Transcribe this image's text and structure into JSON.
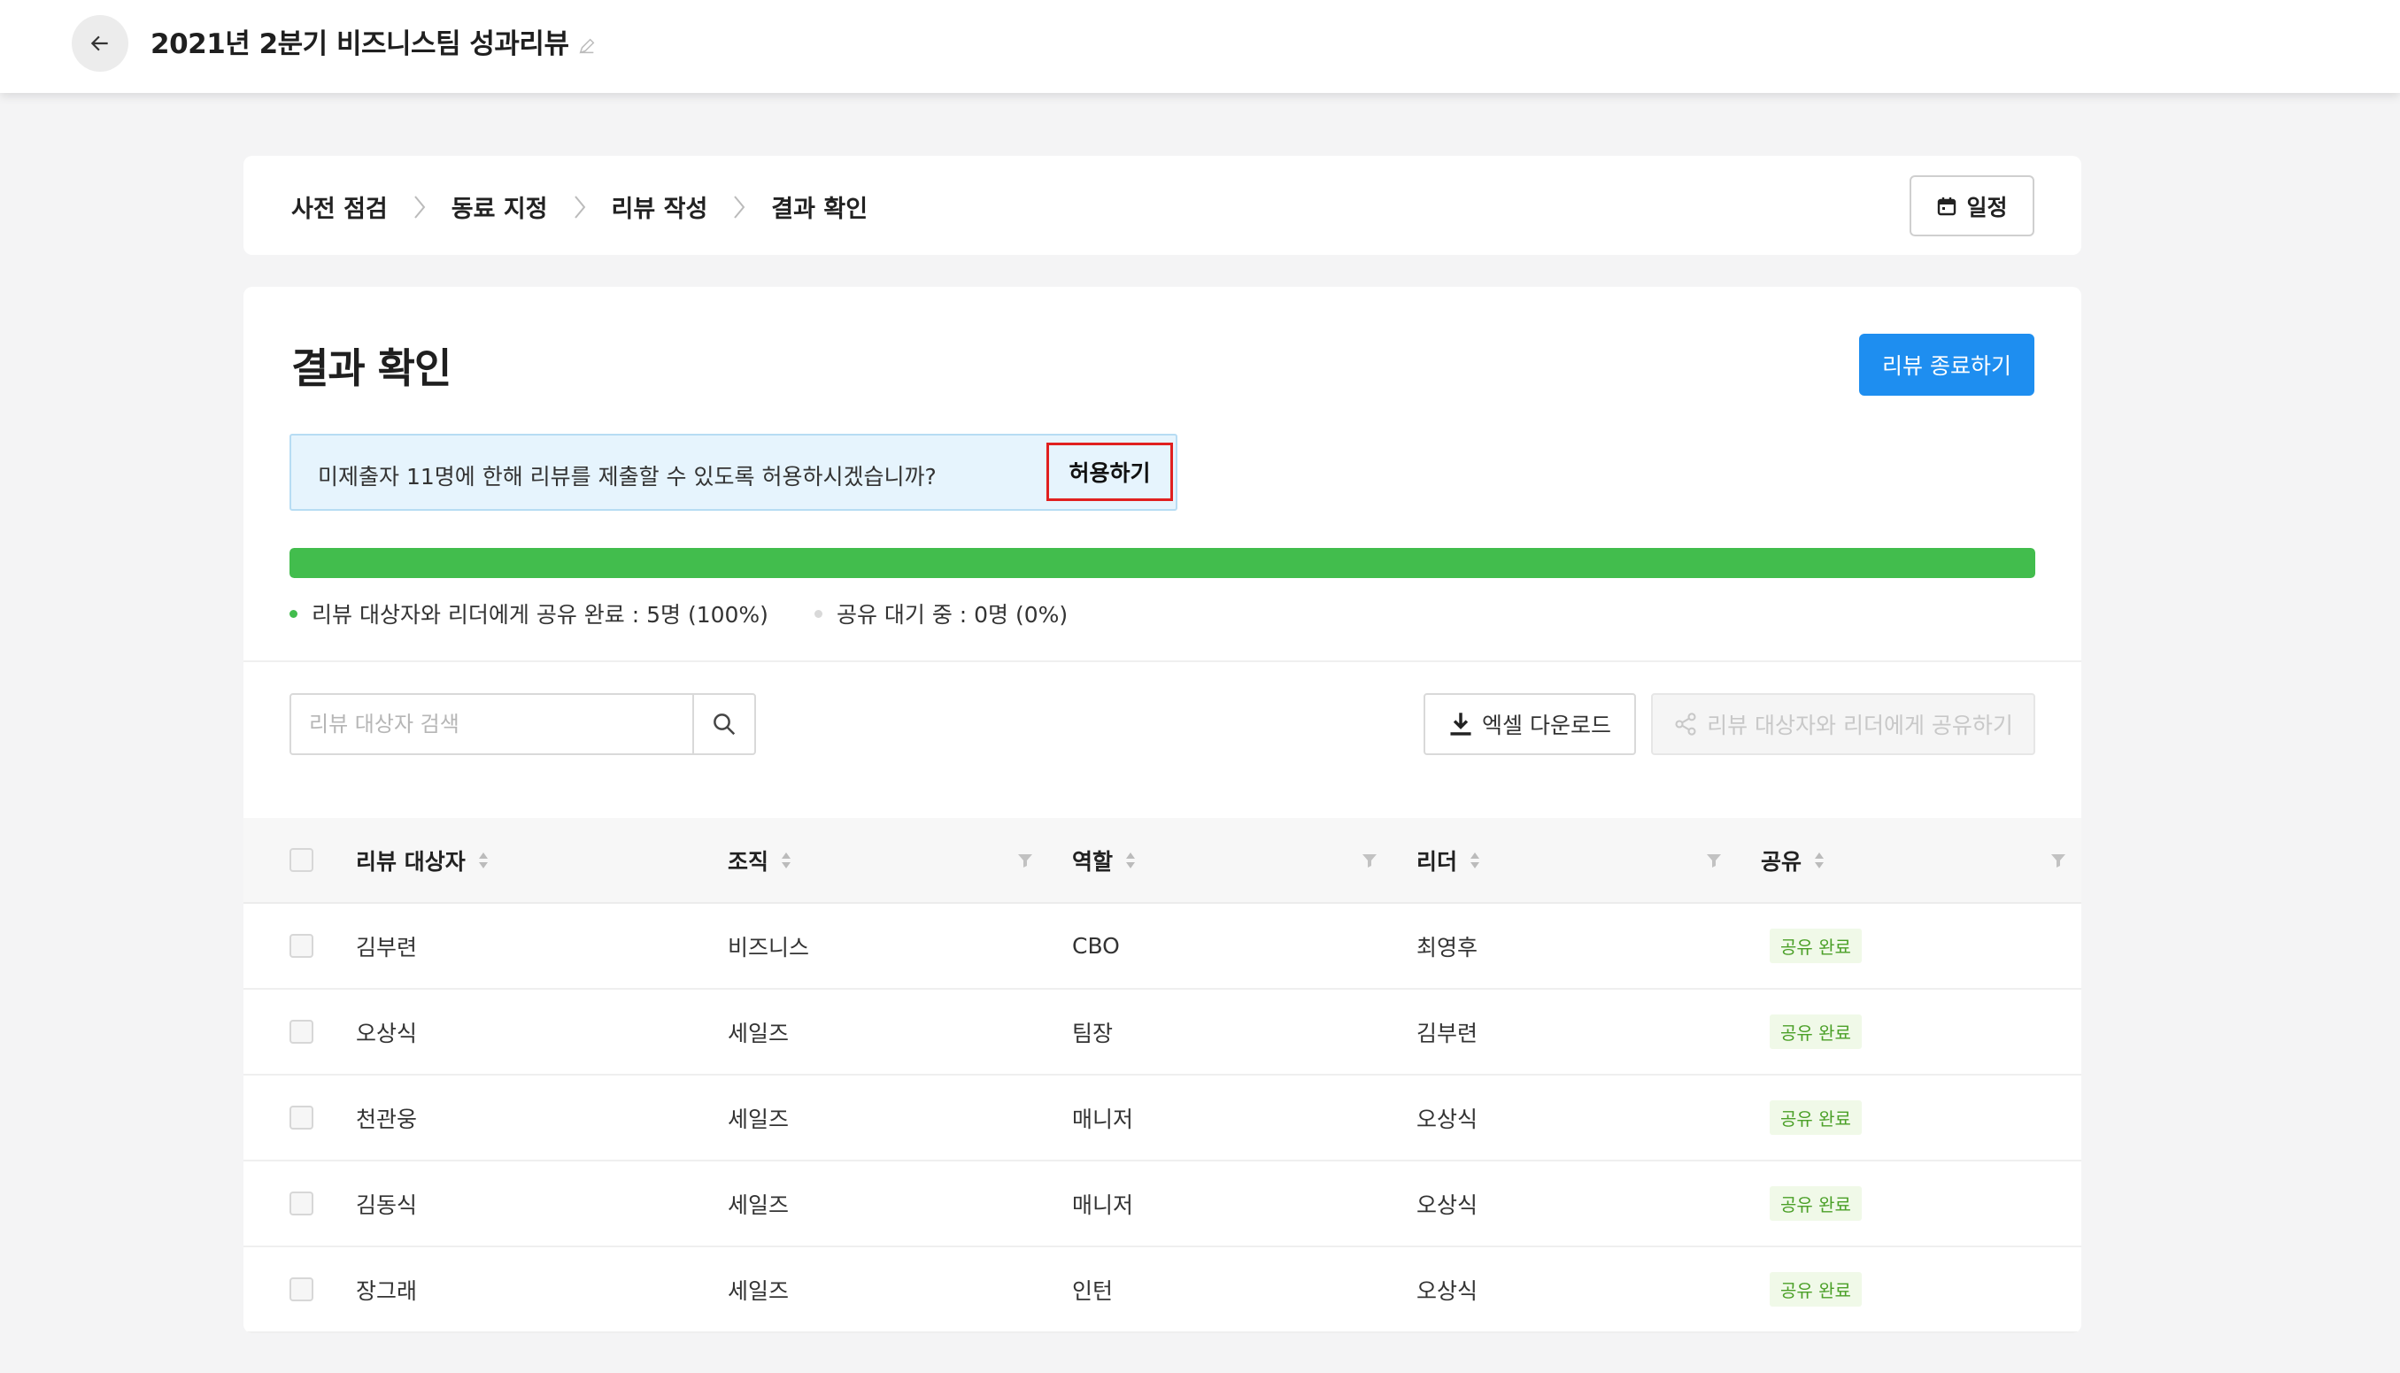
{
  "header": {
    "title": "2021년 2분기 비즈니스팀 성과리뷰"
  },
  "steps": [
    "사전 점검",
    "동료 지정",
    "리뷰 작성",
    "결과 확인"
  ],
  "schedule_label": "일정",
  "section": {
    "title": "결과 확인",
    "end_button": "리뷰 종료하기"
  },
  "notice": {
    "text": "미제출자 11명에 한해 리뷰를 제출할 수 있도록 허용하시겠습니까?",
    "allow_button": "허용하기"
  },
  "progress": {
    "shared_percent": 100,
    "legend": [
      {
        "label": "리뷰 대상자와 리더에게 공유 완료 : 5명 (100%)",
        "color": "#42bd4d"
      },
      {
        "label": "공유 대기 중 : 0명 (0%)",
        "color": "#d9d9d9"
      }
    ]
  },
  "toolbar": {
    "search_placeholder": "리뷰 대상자 검색",
    "excel_button": "엑셀 다운로드",
    "share_button": "리뷰 대상자와 리더에게 공유하기"
  },
  "table": {
    "columns": [
      "리뷰 대상자",
      "조직",
      "역할",
      "리더",
      "공유"
    ],
    "rows": [
      {
        "name": "김부련",
        "org": "비즈니스",
        "role": "CBO",
        "leader": "최영후",
        "share": "공유 완료"
      },
      {
        "name": "오상식",
        "org": "세일즈",
        "role": "팀장",
        "leader": "김부련",
        "share": "공유 완료"
      },
      {
        "name": "천관웅",
        "org": "세일즈",
        "role": "매니저",
        "leader": "오상식",
        "share": "공유 완료"
      },
      {
        "name": "김동식",
        "org": "세일즈",
        "role": "매니저",
        "leader": "오상식",
        "share": "공유 완료"
      },
      {
        "name": "장그래",
        "org": "세일즈",
        "role": "인턴",
        "leader": "오상식",
        "share": "공유 완료"
      }
    ]
  },
  "colors": {
    "primary": "#1e8ef0",
    "success": "#42bd4d",
    "highlight": "#e0201f"
  }
}
